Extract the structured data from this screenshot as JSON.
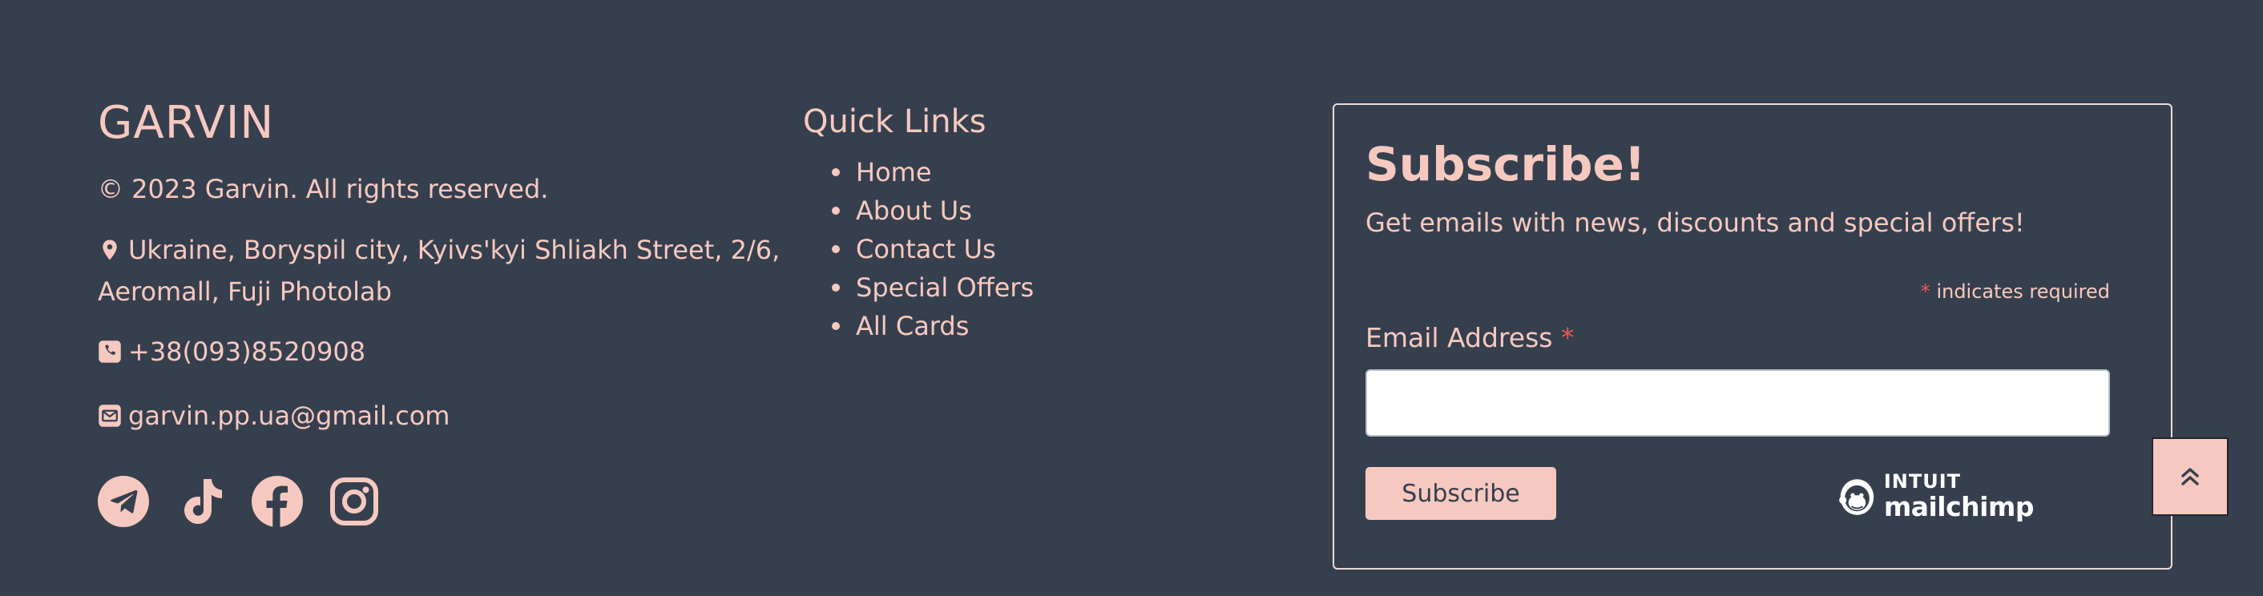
{
  "brand": {
    "name": "GARVIN",
    "copyright": "© 2023 Garvin. All rights reserved."
  },
  "contact": {
    "address_line1": "Ukraine, Boryspil city, Kyivs'kyi Shliakh Street, 2/6,",
    "address_line2": "Aeromall, Fuji Photolab",
    "phone": "+38(093)8520908",
    "email": "garvin.pp.ua@gmail.com",
    "address_icon": "map-marker-icon",
    "phone_icon": "phone-square-icon",
    "email_icon": "envelope-icon"
  },
  "socials": [
    {
      "icon": "telegram-icon"
    },
    {
      "icon": "tiktok-icon"
    },
    {
      "icon": "facebook-icon"
    },
    {
      "icon": "instagram-icon"
    }
  ],
  "quick_links": {
    "title": "Quick Links",
    "items": [
      {
        "label": "Home"
      },
      {
        "label": "About Us"
      },
      {
        "label": "Contact Us"
      },
      {
        "label": "Special Offers"
      },
      {
        "label": "All Cards"
      }
    ]
  },
  "subscribe": {
    "title": "Subscribe!",
    "description": "Get emails with news, discounts and special offers!",
    "required_star": "*",
    "required_note": "indicates required",
    "email_label": "Email Address",
    "email_value": "",
    "button_label": "Subscribe",
    "badge_top": "INTUIT",
    "badge_name": "mailchimp"
  },
  "scroll_top": {
    "icon": "double-chevron-up-icon"
  },
  "colors": {
    "background": "#363f4d",
    "accent": "#f6c9c0",
    "required": "#e85b4d"
  }
}
